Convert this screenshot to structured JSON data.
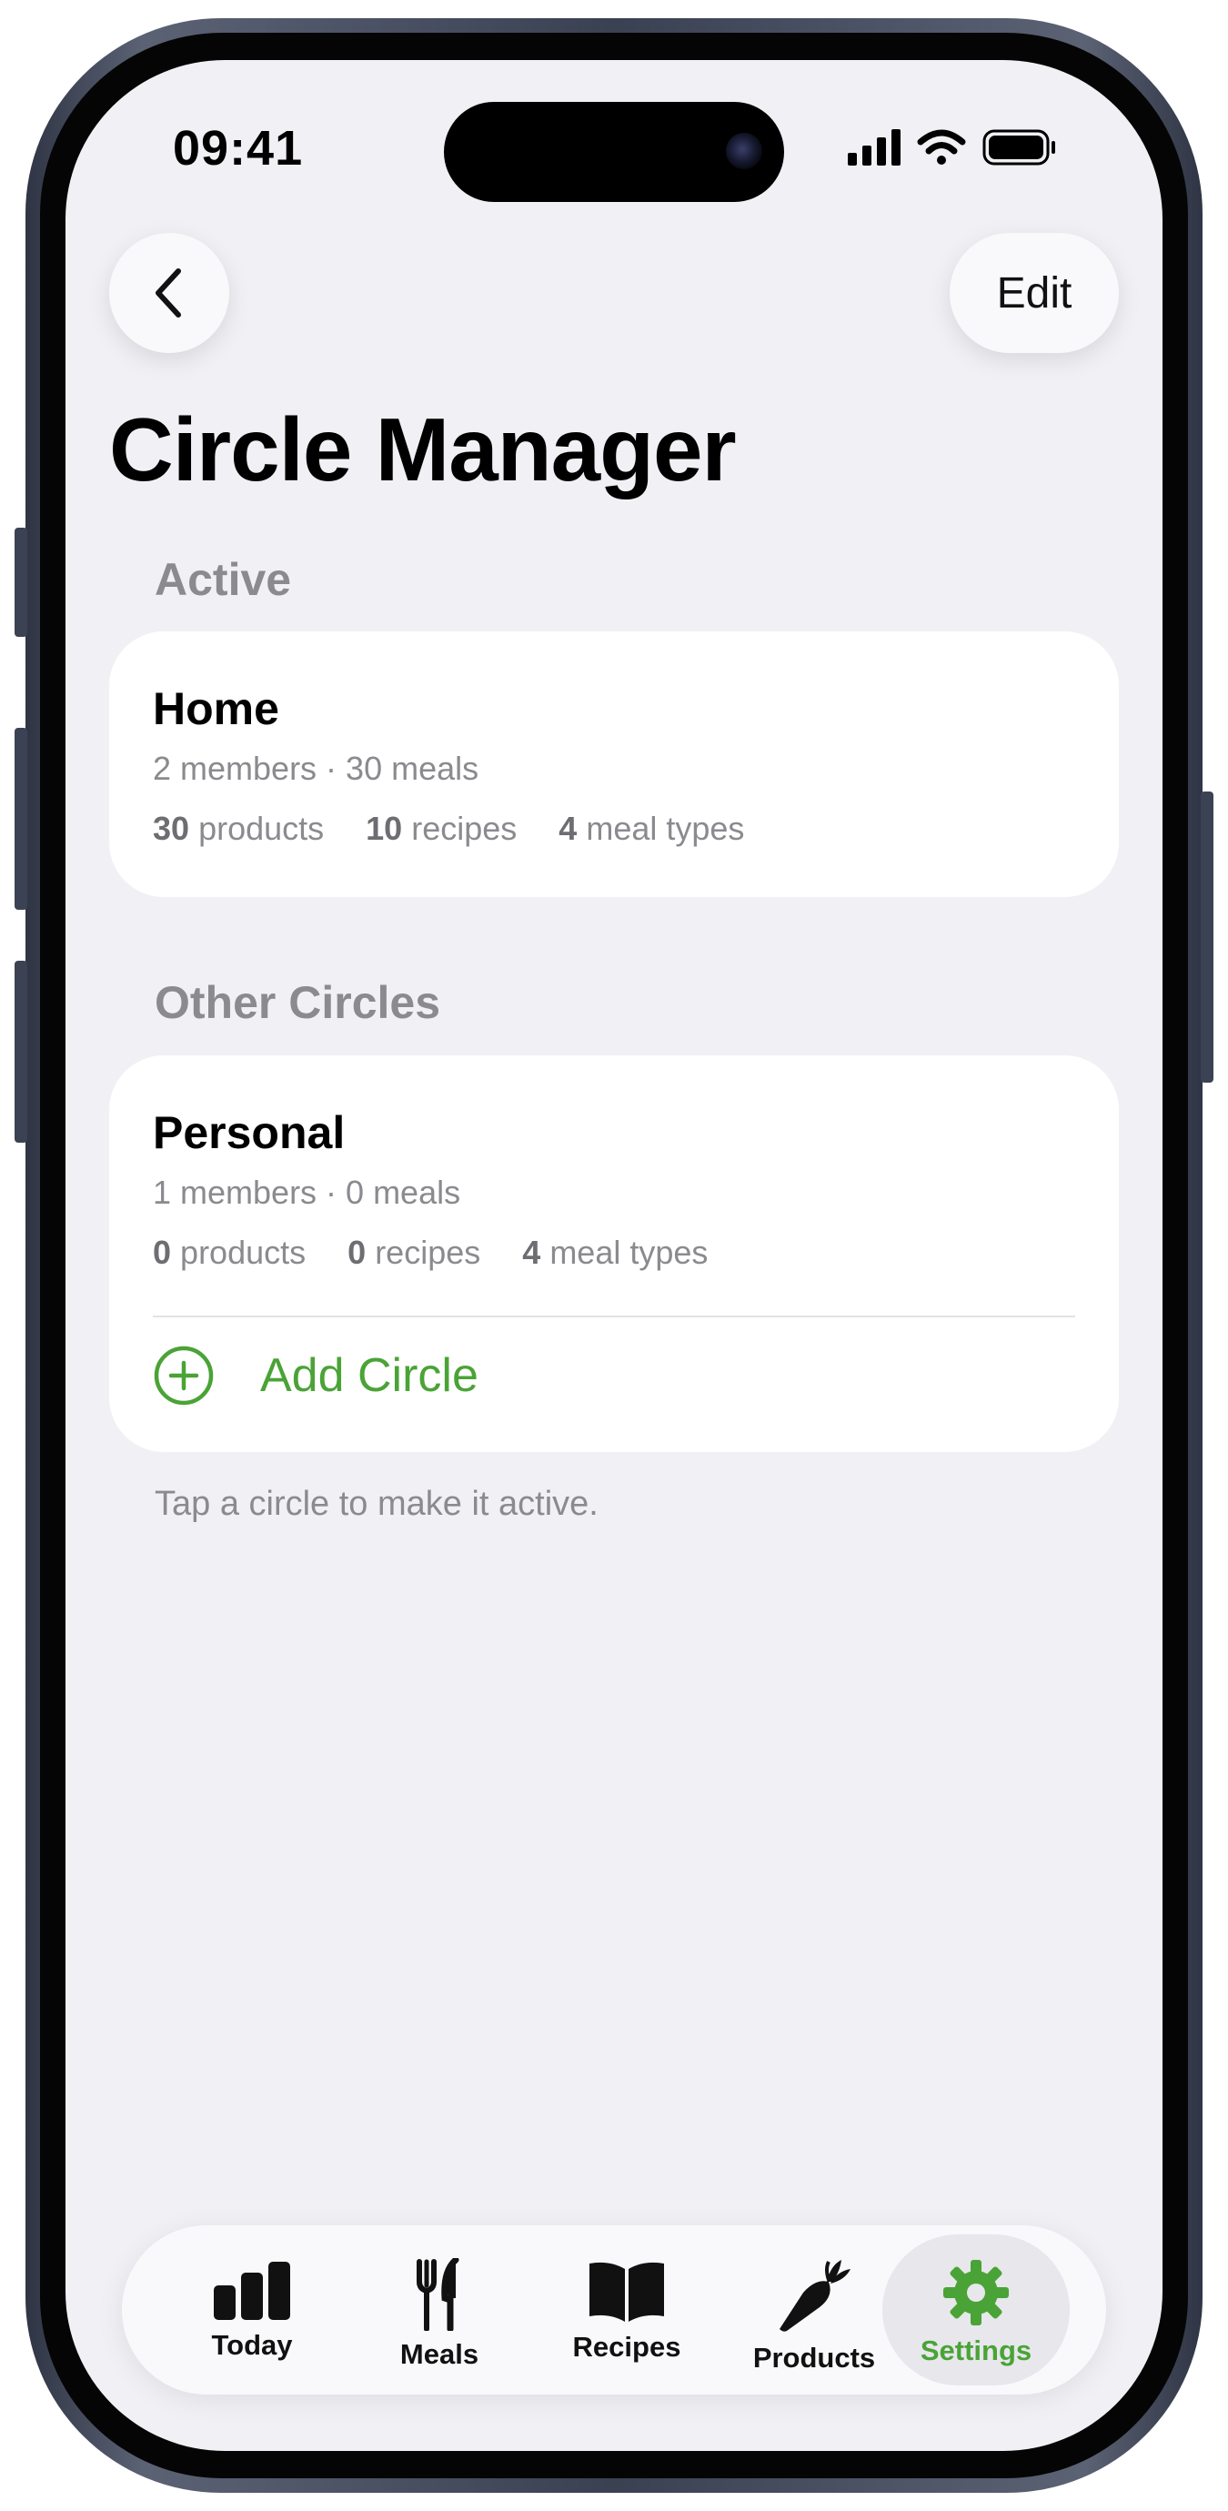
{
  "status_bar": {
    "time": "09:41"
  },
  "nav": {
    "back_icon": "chevron-left-icon",
    "edit_label": "Edit"
  },
  "page_title": "Circle Manager",
  "active_section": {
    "label": "Active",
    "circle": {
      "name": "Home",
      "meta": "2 members · 30 meals",
      "products_count": "30",
      "products_label": "products",
      "recipes_count": "10",
      "recipes_label": "recipes",
      "meal_types_count": "4",
      "meal_types_label": "meal types"
    }
  },
  "other_section": {
    "label": "Other Circles",
    "circles": [
      {
        "name": "Personal",
        "meta": "1 members · 0 meals",
        "products_count": "0",
        "products_label": "products",
        "recipes_count": "0",
        "recipes_label": "recipes",
        "meal_types_count": "4",
        "meal_types_label": "meal types"
      }
    ],
    "add_label": "Add Circle",
    "add_icon": "plus-circle-icon"
  },
  "footnote": "Tap a circle to make it active.",
  "tab_bar": {
    "tabs": [
      {
        "label": "Today",
        "icon": "bar-chart-icon"
      },
      {
        "label": "Meals",
        "icon": "fork-knife-icon"
      },
      {
        "label": "Recipes",
        "icon": "book-icon"
      },
      {
        "label": "Products",
        "icon": "carrot-icon"
      },
      {
        "label": "Settings",
        "icon": "gear-icon"
      }
    ],
    "active_tab": "Settings",
    "accent_color": "#4aa336"
  },
  "colors": {
    "background": "#f1f0f5",
    "card": "#ffffff",
    "secondary_text": "#8a8a8f",
    "accent": "#4aa336"
  }
}
